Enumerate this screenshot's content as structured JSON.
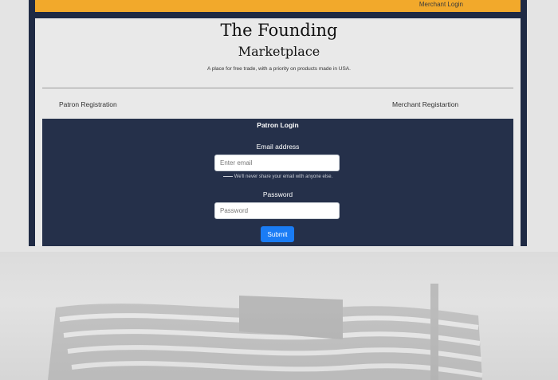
{
  "header": {
    "merchant_login": "Merchant Login"
  },
  "brand": {
    "title_line1": "The Founding",
    "title_line2": "Marketplace",
    "tagline": "A place for free trade, with a priority on products made in USA."
  },
  "nav": {
    "patron_registration": "Patron Registration",
    "merchant_registration": "Merchant Registartion"
  },
  "login": {
    "title": "Patron Login",
    "email_label": "Email address",
    "email_placeholder": "Enter email",
    "email_help": "We'll never share your email with anyone else.",
    "password_label": "Password",
    "password_placeholder": "Password",
    "submit_label": "Submit"
  },
  "colors": {
    "accent_bar": "#f2a92b",
    "frame": "#1f2a44",
    "login_panel": "#25304a",
    "submit_button": "#1a7cf5"
  }
}
